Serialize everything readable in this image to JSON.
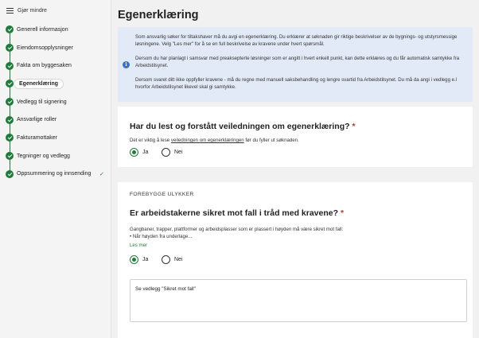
{
  "sidebar": {
    "toggle_label": "Gjør mindre",
    "steps": [
      {
        "label": "Generell informasjon"
      },
      {
        "label": "Eiendomsopplysninger"
      },
      {
        "label": "Fakta om byggesaken"
      },
      {
        "label": "Egenerklæring"
      },
      {
        "label": "Vedlegg til signering"
      },
      {
        "label": "Ansvarlige roller"
      },
      {
        "label": "Fakturamottaker"
      },
      {
        "label": "Tegninger og vedlegg"
      },
      {
        "label": "Oppsummering og innsending"
      }
    ],
    "active_step": "Egenerklæring",
    "check_mark": "✓"
  },
  "main": {
    "title": "Egenerklæring",
    "info": {
      "icon": "info-icon",
      "icon_glyph": "i",
      "paragraph1": "Som ansvarlig søker for tiltakshaver må du avgi en egenerklæring. Du erklærer at søknaden gir riktige beskrivelser av de bygnings- og utstyrsmessige løsningene. Velg \"Les mer\" for å se en full beskrivelse av kravene under hvert spørsmål.",
      "paragraph2": "Dersom du har planlagt i samsvar med preaksepterte løsninger som er angitt i hvert enkelt punkt, kan dette erklæres og du får automatisk samtykke fra Arbeidstilsynet.",
      "paragraph3": "Dersom svaret ditt ikke oppfyller kravene - må du regne med manuell saksbehandling og lengre svartid fra Arbeidstilsynet. Du må da angi i vedlegg e.l hvorfor Arbeidstilsynet likevel skal gi samtykke."
    },
    "question1": {
      "title": "Har du lest og forstått veiledningen om egenerklæring?",
      "required_mark": "*",
      "help_prefix": "Det er viktig å lese ",
      "help_link": "veiledningen om egenerklæringen",
      "help_suffix": " før du fyller ut søknaden.",
      "option_yes": "Ja",
      "option_no": "Nei",
      "selected": "Ja"
    },
    "question2": {
      "section": "FOREBYGGE ULYKKER",
      "title": "Er arbeidstakerne sikret mot fall i tråd med kravene?",
      "required_mark": "*",
      "help_line1": "Gangbaner, trapper, plattformer og arbeidsplasser som er plassert i høyden må være sikret mot fall:",
      "help_line2": "• Når høyden fra underlage...",
      "read_more": "Les mer",
      "option_yes": "Ja",
      "option_no": "Nei",
      "selected": "Ja",
      "comment_value": "Se vedlegg \"Sikret mot fall\""
    }
  },
  "colors": {
    "accent_green": "#1e7c3a",
    "info_bg": "#e2e9f7",
    "info_icon": "#3b6fd6",
    "required": "#c0392b"
  }
}
